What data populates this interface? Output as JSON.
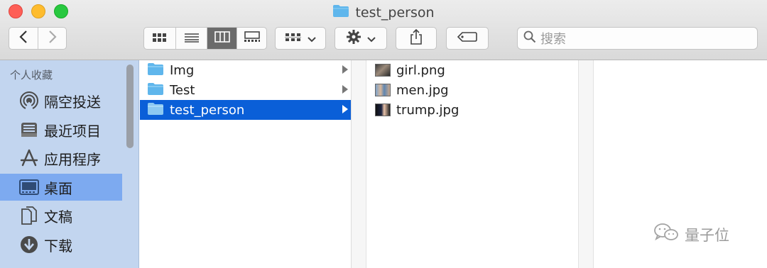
{
  "window": {
    "title": "test_person",
    "traffic_lights": {
      "close": "#fe5f57",
      "minimize": "#febc2e",
      "zoom": "#28c840"
    }
  },
  "toolbar": {
    "back_icon": "chevron-left-icon",
    "forward_icon": "chevron-right-icon",
    "view_modes": [
      "icon-view-icon",
      "list-view-icon",
      "column-view-icon",
      "gallery-view-icon"
    ],
    "active_view": "column-view-icon",
    "group_icon": "group-by-icon",
    "action_icon": "gear-icon",
    "share_icon": "share-icon",
    "tag_icon": "tag-icon",
    "search": {
      "placeholder": "搜索",
      "icon": "search-icon"
    }
  },
  "sidebar": {
    "heading": "个人收藏",
    "items": [
      {
        "label": "隔空投送",
        "icon": "airdrop-icon",
        "selected": false
      },
      {
        "label": "最近项目",
        "icon": "recents-icon",
        "selected": false
      },
      {
        "label": "应用程序",
        "icon": "applications-icon",
        "selected": false
      },
      {
        "label": "桌面",
        "icon": "desktop-icon",
        "selected": true
      },
      {
        "label": "文稿",
        "icon": "documents-icon",
        "selected": false
      },
      {
        "label": "下载",
        "icon": "downloads-icon",
        "selected": false
      }
    ]
  },
  "columns": {
    "folders": [
      {
        "name": "Img",
        "selected": false
      },
      {
        "name": "Test",
        "selected": false
      },
      {
        "name": "test_person",
        "selected": true
      }
    ],
    "files": [
      {
        "name": "girl.png"
      },
      {
        "name": "men.jpg"
      },
      {
        "name": "trump.jpg"
      }
    ]
  },
  "watermark": {
    "text": "量子位",
    "icon": "wechat-icon"
  },
  "colors": {
    "accent": "#0a5fd8",
    "sidebar_bg": "#c2d5ef",
    "sidebar_selected": "#7daaf0",
    "folder": "#5fb6ec"
  }
}
